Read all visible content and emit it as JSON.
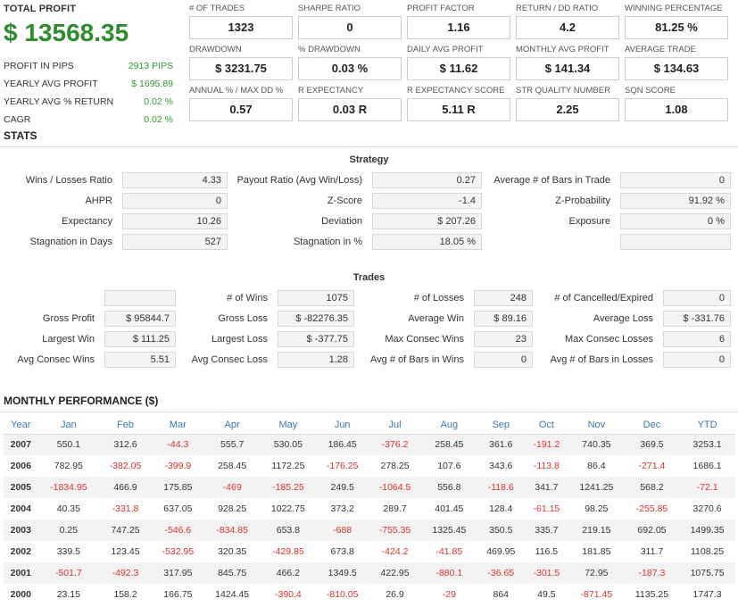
{
  "summary": {
    "total_profit_label": "TOTAL PROFIT",
    "total_profit_value": "$ 13568.35",
    "rows": [
      {
        "label": "PROFIT IN PIPS",
        "value": "2913 PIPS"
      },
      {
        "label": "YEARLY AVG PROFIT",
        "value": "$ 1695.89"
      },
      {
        "label": "YEARLY AVG % RETURN",
        "value": "0.02 %"
      },
      {
        "label": "CAGR",
        "value": "0.02 %"
      }
    ]
  },
  "metrics": [
    {
      "label": "# OF TRADES",
      "value": "1323"
    },
    {
      "label": "SHARPE RATIO",
      "value": "0"
    },
    {
      "label": "PROFIT FACTOR",
      "value": "1.16"
    },
    {
      "label": "RETURN / DD RATIO",
      "value": "4.2"
    },
    {
      "label": "WINNING PERCENTAGE",
      "value": "81.25 %"
    },
    {
      "label": "DRAWDOWN",
      "value": "$ 3231.75"
    },
    {
      "label": "% DRAWDOWN",
      "value": "0.03 %"
    },
    {
      "label": "DAILY AVG PROFIT",
      "value": "$ 11.62"
    },
    {
      "label": "MONTHLY AVG PROFIT",
      "value": "$ 141.34"
    },
    {
      "label": "AVERAGE TRADE",
      "value": "$ 134.63"
    },
    {
      "label": "ANNUAL % / MAX DD %",
      "value": "0.57"
    },
    {
      "label": "R EXPECTANCY",
      "value": "0.03 R"
    },
    {
      "label": "R EXPECTANCY SCORE",
      "value": "5.11 R"
    },
    {
      "label": "STR QUALITY NUMBER",
      "value": "2.25"
    },
    {
      "label": "SQN SCORE",
      "value": "1.08"
    }
  ],
  "stats": {
    "title": "STATS",
    "strategy_title": "Strategy",
    "strategy": [
      [
        {
          "label": "Wins / Losses Ratio",
          "value": "4.33"
        },
        {
          "label": "Payout Ratio (Avg Win/Loss)",
          "value": "0.27"
        },
        {
          "label": "Average # of Bars in Trade",
          "value": "0"
        }
      ],
      [
        {
          "label": "AHPR",
          "value": "0"
        },
        {
          "label": "Z-Score",
          "value": "-1.4"
        },
        {
          "label": "Z-Probability",
          "value": "91.92 %"
        }
      ],
      [
        {
          "label": "Expectancy",
          "value": "10.26"
        },
        {
          "label": "Deviation",
          "value": "$ 207.26"
        },
        {
          "label": "Exposure",
          "value": "0 %"
        }
      ],
      [
        {
          "label": "Stagnation in Days",
          "value": "527"
        },
        {
          "label": "Stagnation in %",
          "value": "18.05 %"
        },
        {
          "label": "",
          "value": ""
        }
      ]
    ],
    "trades_title": "Trades",
    "trades": [
      [
        {
          "label": "",
          "value": ""
        },
        {
          "label": "# of Wins",
          "value": "1075"
        },
        {
          "label": "# of Losses",
          "value": "248"
        },
        {
          "label": "# of Cancelled/Expired",
          "value": "0"
        }
      ],
      [
        {
          "label": "Gross Profit",
          "value": "$ 95844.7"
        },
        {
          "label": "Gross Loss",
          "value": "$ -82276.35"
        },
        {
          "label": "Average Win",
          "value": "$ 89.16"
        },
        {
          "label": "Average Loss",
          "value": "$ -331.76"
        }
      ],
      [
        {
          "label": "Largest Win",
          "value": "$ 111.25"
        },
        {
          "label": "Largest Loss",
          "value": "$ -377.75"
        },
        {
          "label": "Max Consec Wins",
          "value": "23"
        },
        {
          "label": "Max Consec Losses",
          "value": "6"
        }
      ],
      [
        {
          "label": "Avg Consec Wins",
          "value": "5.51"
        },
        {
          "label": "Avg Consec Loss",
          "value": "1.28"
        },
        {
          "label": "Avg # of Bars in Wins",
          "value": "0"
        },
        {
          "label": "Avg # of Bars in Losses",
          "value": "0"
        }
      ]
    ]
  },
  "monthly": {
    "title": "MONTHLY PERFORMANCE ($)",
    "headers": [
      "Year",
      "Jan",
      "Feb",
      "Mar",
      "Apr",
      "May",
      "Jun",
      "Jul",
      "Aug",
      "Sep",
      "Oct",
      "Nov",
      "Dec",
      "YTD"
    ],
    "rows": [
      [
        "2007",
        "550.1",
        "312.6",
        "-44.3",
        "555.7",
        "530.05",
        "186.45",
        "-376.2",
        "258.45",
        "361.6",
        "-191.2",
        "740.35",
        "369.5",
        "3253.1"
      ],
      [
        "2006",
        "782.95",
        "-382.05",
        "-399.9",
        "258.45",
        "1172.25",
        "-176.25",
        "278.25",
        "107.6",
        "343.6",
        "-113.8",
        "86.4",
        "-271.4",
        "1686.1"
      ],
      [
        "2005",
        "-1834.95",
        "466.9",
        "175.85",
        "-469",
        "-185.25",
        "249.5",
        "-1064.5",
        "556.8",
        "-118.6",
        "341.7",
        "1241.25",
        "568.2",
        "-72.1"
      ],
      [
        "2004",
        "40.35",
        "-331.8",
        "637.05",
        "928.25",
        "1022.75",
        "373.2",
        "289.7",
        "401.45",
        "128.4",
        "-61.15",
        "98.25",
        "-255.85",
        "3270.6"
      ],
      [
        "2003",
        "0.25",
        "747.25",
        "-546.6",
        "-834.85",
        "653.8",
        "-688",
        "-755.35",
        "1325.45",
        "350.5",
        "335.7",
        "219.15",
        "692.05",
        "1499.35"
      ],
      [
        "2002",
        "339.5",
        "123.45",
        "-532.95",
        "320.35",
        "-429.85",
        "673.8",
        "-424.2",
        "-41.85",
        "469.95",
        "116.5",
        "181.85",
        "311.7",
        "1108.25"
      ],
      [
        "2001",
        "-501.7",
        "-492.3",
        "317.95",
        "845.75",
        "466.2",
        "1349.5",
        "422.95",
        "-880.1",
        "-36.65",
        "-301.5",
        "72.95",
        "-187.3",
        "1075.75"
      ],
      [
        "2000",
        "23.15",
        "158.2",
        "166.75",
        "1424.45",
        "-390.4",
        "-810.05",
        "26.9",
        "-29",
        "864",
        "49.5",
        "-871.45",
        "1135.25",
        "1747.3"
      ]
    ]
  }
}
